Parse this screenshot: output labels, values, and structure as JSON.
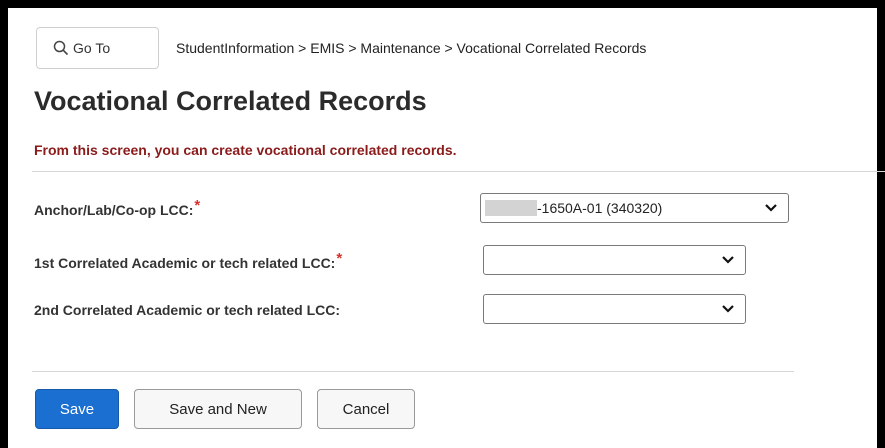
{
  "goto": {
    "label": "Go To"
  },
  "breadcrumb": "StudentInformation > EMIS > Maintenance > Vocational Correlated Records",
  "page": {
    "title": "Vocational Correlated Records",
    "subtitle": "From this screen, you can create vocational correlated records."
  },
  "form": {
    "anchor_label": "Anchor/Lab/Co-op LCC:",
    "anchor_value": "-1650A-01 (340320)",
    "first_label": "1st Correlated Academic or tech related LCC:",
    "first_value": "",
    "second_label": "2nd Correlated Academic or tech related LCC:",
    "second_value": "",
    "required_mark": "*"
  },
  "buttons": {
    "save": "Save",
    "save_and_new": "Save and New",
    "cancel": "Cancel"
  },
  "colors": {
    "primary": "#1a6fd1",
    "subtitle": "#8b1a1a",
    "required": "#d8302d"
  }
}
